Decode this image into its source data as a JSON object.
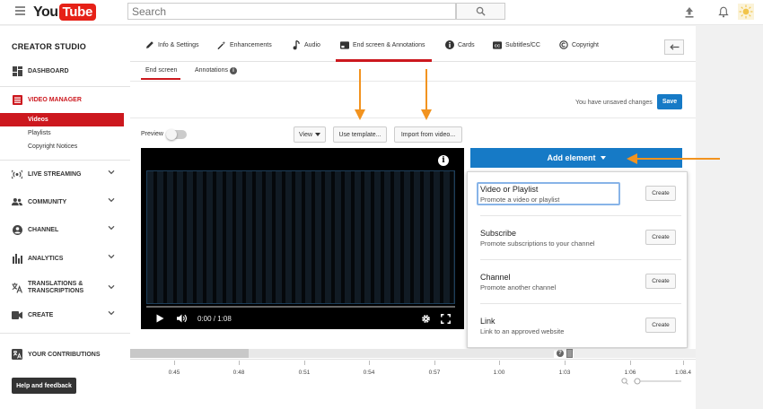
{
  "topbar": {
    "logo_you": "You",
    "logo_tube": "Tube",
    "search_placeholder": "Search",
    "icons": [
      "menu-icon",
      "search-icon",
      "upload-icon",
      "bell-icon",
      "avatar"
    ]
  },
  "sidebar": {
    "title": "CREATOR STUDIO",
    "items": [
      {
        "label": "DASHBOARD",
        "icon": "dashboard-icon"
      },
      {
        "label": "VIDEO MANAGER",
        "icon": "video-manager-icon"
      },
      {
        "label": "LIVE STREAMING",
        "icon": "live-icon"
      },
      {
        "label": "COMMUNITY",
        "icon": "community-icon"
      },
      {
        "label": "CHANNEL",
        "icon": "channel-icon"
      },
      {
        "label": "ANALYTICS",
        "icon": "analytics-icon"
      },
      {
        "label": "TRANSLATIONS &",
        "label2": "TRANSCRIPTIONS",
        "icon": "translate-icon"
      },
      {
        "label": "CREATE",
        "icon": "create-icon"
      },
      {
        "label": "YOUR CONTRIBUTIONS",
        "icon": "contributions-icon"
      }
    ],
    "sub_items": [
      "Videos",
      "Playlists",
      "Copyright Notices"
    ],
    "help_label": "Help and feedback"
  },
  "tabs": [
    {
      "label": "Info & Settings",
      "icon": "pencil-icon"
    },
    {
      "label": "Enhancements",
      "icon": "wand-icon"
    },
    {
      "label": "Audio",
      "icon": "music-note-icon"
    },
    {
      "label": "End screen & Annotations",
      "icon": "end-screen-icon"
    },
    {
      "label": "Cards",
      "icon": "info-icon"
    },
    {
      "label": "Subtitles/CC",
      "icon": "cc-icon"
    },
    {
      "label": "Copyright",
      "icon": "copyright-icon"
    }
  ],
  "subtabs": [
    "End screen",
    "Annotations"
  ],
  "status": {
    "unsaved": "You have unsaved changes",
    "save": "Save"
  },
  "controls": {
    "preview": "Preview",
    "view": "View",
    "use_template": "Use template...",
    "import_from_video": "Import from video..."
  },
  "player": {
    "time": "0:00 / 1:08",
    "progress": 0.0
  },
  "add_element": {
    "label": "Add element",
    "items": [
      {
        "title": "Video or Playlist",
        "desc": "Promote a video or playlist",
        "button": "Create"
      },
      {
        "title": "Subscribe",
        "desc": "Promote subscriptions to your channel",
        "button": "Create"
      },
      {
        "title": "Channel",
        "desc": "Promote another channel",
        "button": "Create"
      },
      {
        "title": "Link",
        "desc": "Link to an approved website",
        "button": "Create"
      }
    ]
  },
  "timeline": {
    "labels": [
      "0:45",
      "0:48",
      "0:51",
      "0:54",
      "0:57",
      "1:00",
      "1:03",
      "1:06",
      "1:08.4"
    ]
  },
  "colors": {
    "brand_red": "#cc181e",
    "accent_blue": "#167ac6",
    "arrow_orange": "#f2931f"
  }
}
